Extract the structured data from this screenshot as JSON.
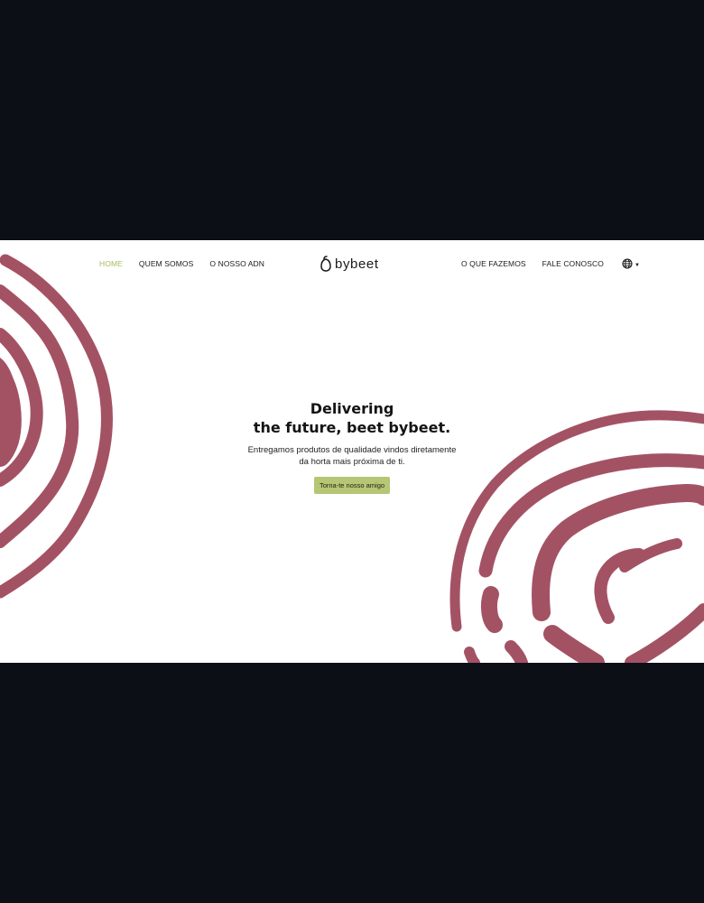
{
  "nav": {
    "left": [
      {
        "label": "HOME",
        "active": true
      },
      {
        "label": "QUEM SOMOS",
        "active": false
      },
      {
        "label": "O NOSSO ADN",
        "active": false
      }
    ],
    "right": [
      {
        "label": "O QUE FAZEMOS",
        "active": false
      },
      {
        "label": "FALE CONOSCO",
        "active": false
      }
    ],
    "language_icon": "globe-icon"
  },
  "brand": {
    "name": "bybeet",
    "logo_icon": "beet-logo-icon"
  },
  "hero": {
    "title_line1": "Delivering",
    "title_line2": "the future, beet bybeet.",
    "subtitle_line1": "Entregamos produtos de qualidade vindos diretamente",
    "subtitle_line2": "da horta mais próxima de ti.",
    "cta_label": "Torna-te nosso amigo"
  },
  "colors": {
    "background_outer": "#0c0f16",
    "page_background": "#ffffff",
    "accent_green": "#a6c05a",
    "button_green": "#b5c675",
    "beet_ring": "#a35264"
  }
}
